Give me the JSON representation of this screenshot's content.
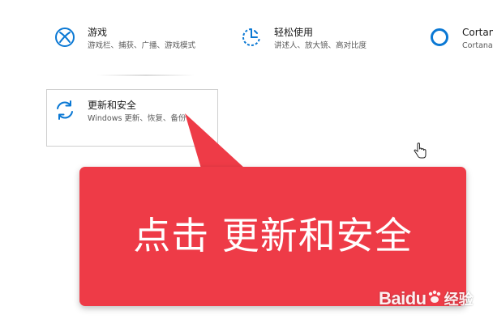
{
  "settings": {
    "tiles": [
      {
        "title": "游戏",
        "subtitle": "游戏栏、捕获、广播、游戏模式",
        "icon": "xbox-icon"
      },
      {
        "title": "轻松使用",
        "subtitle": "讲述人、放大镜、高对比度",
        "icon": "ease-of-access-icon"
      },
      {
        "title": "Cortana",
        "subtitle": "Cortana",
        "icon": "cortana-icon"
      }
    ],
    "highlighted_tile": {
      "title": "更新和安全",
      "subtitle": "Windows 更新、恢复、备份",
      "icon": "sync-arrows-icon"
    }
  },
  "callout": {
    "text": "点击 更新和安全",
    "color": "#ee3b47"
  },
  "accent_color": "#0a78d4",
  "watermark": {
    "name": "Baidu",
    "tag": "经验"
  }
}
